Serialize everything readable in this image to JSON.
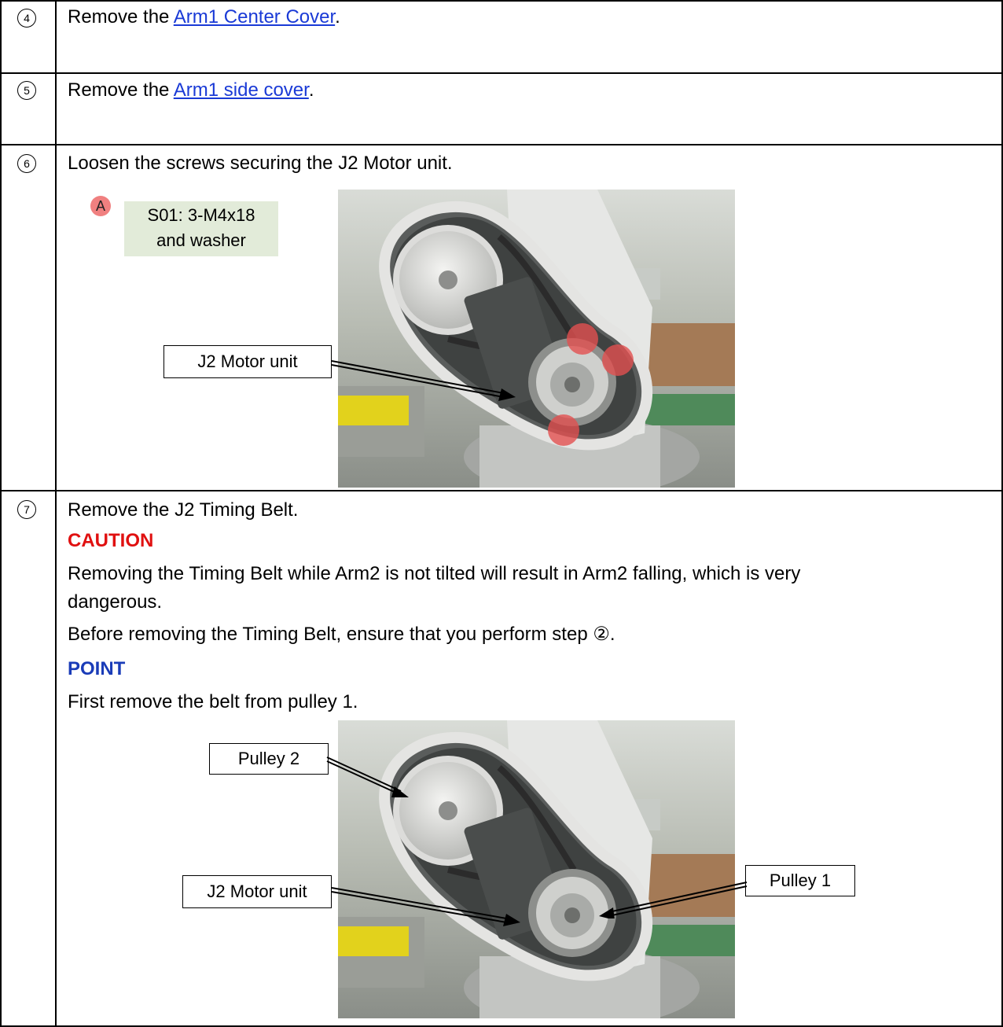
{
  "steps": [
    {
      "num": "4",
      "prefix": "Remove the ",
      "link": "Arm1 Center Cover",
      "suffix": "."
    },
    {
      "num": "5",
      "prefix": "Remove the ",
      "link": "Arm1 side cover",
      "suffix": "."
    },
    {
      "num": "6",
      "text": "Loosen the screws securing the J2 Motor unit.",
      "marker": "A",
      "spec_line1": "S01: 3-M4x18",
      "spec_line2": "and washer",
      "callout_motor": "J2 Motor unit"
    },
    {
      "num": "7",
      "text": "Remove the J2 Timing Belt.",
      "caution_title": "CAUTION",
      "caution_text1": "Removing the Timing Belt while Arm2 is not tilted will result in Arm2 falling, which is very",
      "caution_text2": "dangerous.",
      "caution_text3": "Before removing the Timing Belt, ensure that you perform step ②.",
      "point_title": "POINT",
      "point_text": "First remove the belt from pulley 1.",
      "callout_pulley2": "Pulley 2",
      "callout_motor": "J2 Motor unit",
      "callout_pulley1": "Pulley 1"
    }
  ],
  "colors": {
    "link": "#1a3ad6",
    "caution": "#e01010",
    "point": "#1a3cb8",
    "marker": "#f08080",
    "spec_bg": "#e2ebd9"
  }
}
